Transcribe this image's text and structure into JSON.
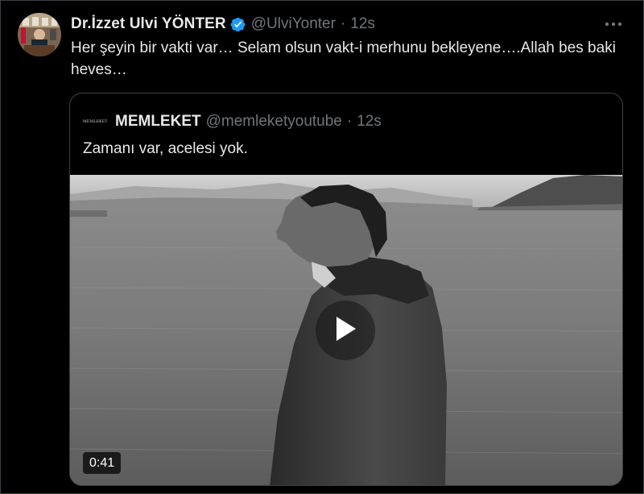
{
  "tweet": {
    "author_name": "Dr.İzzet Ulvi YÖNTER",
    "handle": "@UlviYonter",
    "separator": "·",
    "time": "12s",
    "text": "Her şeyin bir vakti var… Selam olsun vakt-i merhunu bekleyene….Allah bes baki heves…",
    "more_icon": "more-dots-icon",
    "verified_icon": "verified-badge-icon"
  },
  "quote": {
    "logo_text": "MEMLEKET",
    "name": "MEMLEKET",
    "handle": "@memleketyoutube",
    "separator": "·",
    "time": "12s",
    "text": "Zamanı var, acelesi yok."
  },
  "video": {
    "duration": "0:41",
    "play_icon": "play-icon"
  },
  "colors": {
    "background": "#000000",
    "text_primary": "#e7e9ea",
    "text_secondary": "#71767b",
    "border": "#3e4144",
    "verified": "#1d9bf0"
  }
}
